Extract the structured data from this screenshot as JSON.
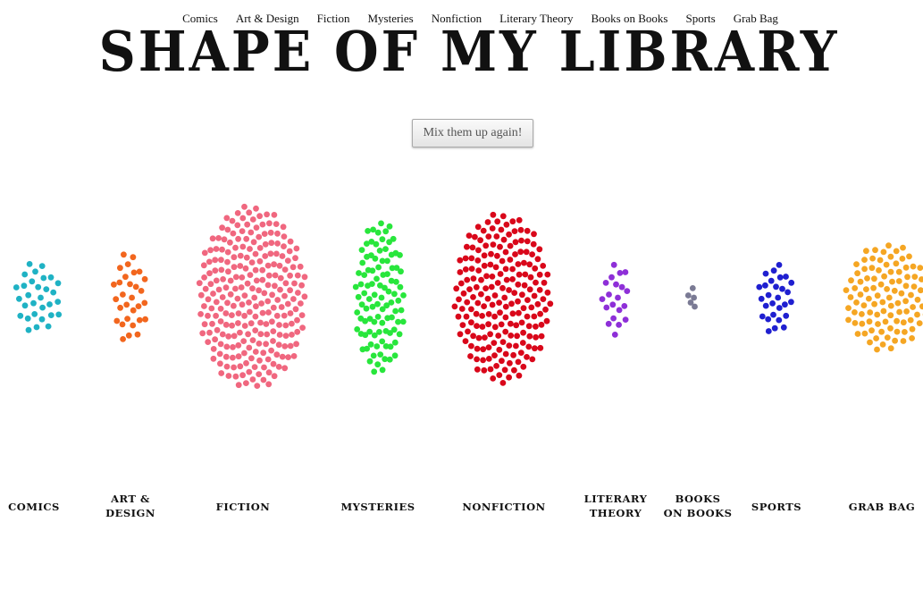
{
  "nav": [
    {
      "label": "Comics",
      "name": "nav-comics"
    },
    {
      "label": "Art & Design",
      "name": "nav-art-design"
    },
    {
      "label": "Fiction",
      "name": "nav-fiction"
    },
    {
      "label": "Mysteries",
      "name": "nav-mysteries"
    },
    {
      "label": "Nonfiction",
      "name": "nav-nonfiction"
    },
    {
      "label": "Literary Theory",
      "name": "nav-literary-theory"
    },
    {
      "label": "Books on Books",
      "name": "nav-books-on-books"
    },
    {
      "label": "Sports",
      "name": "nav-sports"
    },
    {
      "label": "Grab Bag",
      "name": "nav-grab-bag"
    }
  ],
  "title": "SHAPE OF MY LIBRARY",
  "mix_button": "Mix them up again!",
  "chart_data": {
    "type": "scatter",
    "series": [
      {
        "name": "Comics",
        "label_lines": [
          "Comics"
        ],
        "count": 30,
        "color": "#1fb2c4"
      },
      {
        "name": "Art & Design",
        "label_lines": [
          "Art &",
          "Design"
        ],
        "count": 30,
        "color": "#f2661e"
      },
      {
        "name": "Fiction",
        "label_lines": [
          "Fiction"
        ],
        "count": 250,
        "color": "#f0677f"
      },
      {
        "name": "Mysteries",
        "label_lines": [
          "Mysteries"
        ],
        "count": 100,
        "color": "#28e63c"
      },
      {
        "name": "Nonfiction",
        "label_lines": [
          "Nonfiction"
        ],
        "count": 200,
        "color": "#d9071a"
      },
      {
        "name": "Literary Theory",
        "label_lines": [
          "Literary",
          "Theory"
        ],
        "count": 20,
        "color": "#8e2fd8"
      },
      {
        "name": "Books on Books",
        "label_lines": [
          "Books",
          "on Books"
        ],
        "count": 5,
        "color": "#7a7a94"
      },
      {
        "name": "Sports",
        "label_lines": [
          "Sports"
        ],
        "count": 28,
        "color": "#1f1fd0"
      },
      {
        "name": "Grab Bag",
        "label_lines": [
          "Grab Bag"
        ],
        "count": 100,
        "color": "#f5a623"
      }
    ]
  }
}
